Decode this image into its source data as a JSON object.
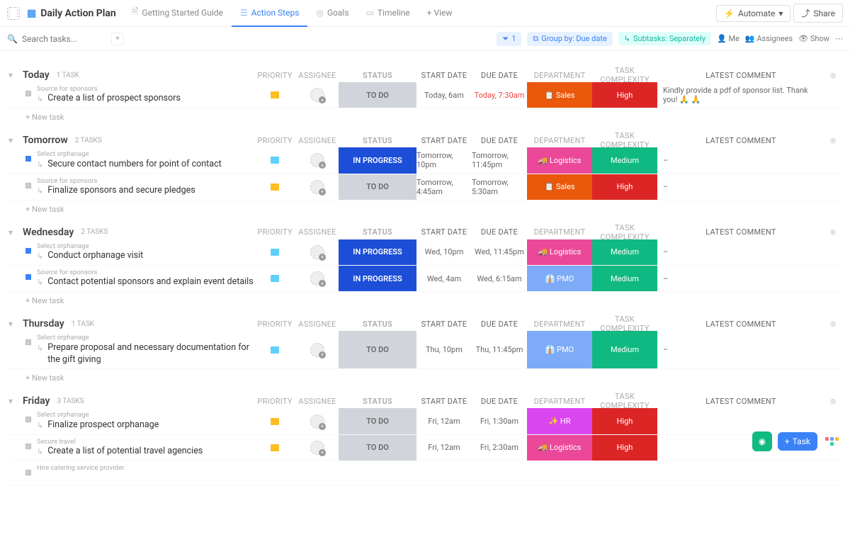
{
  "header": {
    "title": "Daily Action Plan",
    "tabs": [
      {
        "label": "Getting Started Guide"
      },
      {
        "label": "Action Steps"
      },
      {
        "label": "Goals"
      },
      {
        "label": "Timeline"
      }
    ],
    "add_view": "+ View",
    "automate": "Automate",
    "share": "Share"
  },
  "toolbar": {
    "search_placeholder": "Search tasks...",
    "filter_count": "1",
    "group_by": "Group by: Due date",
    "subtasks": "Subtasks: Separately",
    "me": "Me",
    "assignees": "Assignees",
    "show": "Show"
  },
  "columns": {
    "priority": "PRIORITY",
    "assignee": "ASSIGNEE",
    "status": "STATUS",
    "start": "START DATE",
    "due": "DUE DATE",
    "dept": "DEPARTMENT",
    "complex": "TASK COMPLEXITY",
    "comment": "LATEST COMMENT"
  },
  "groups": [
    {
      "name": "Today",
      "count": "1 TASK",
      "tasks": [
        {
          "crumb": "Source for sponsors",
          "name": "Create a list of prospect sponsors",
          "flag": "yellow",
          "status": "TO DO",
          "status_bg": "#d1d5db",
          "status_fg": "#666",
          "start": "Today, 6am",
          "due": "Today, 7:30am",
          "due_red": true,
          "dept": "📋 Sales",
          "dept_bg": "#ea580c",
          "complex": "High",
          "complex_bg": "#dc2626",
          "comment": "Kindly provide a pdf of sponsor list. Thank you! 🙏 🙏",
          "sq": "grey"
        }
      ]
    },
    {
      "name": "Tomorrow",
      "count": "2 TASKS",
      "tasks": [
        {
          "crumb": "Select orphanage",
          "name": "Secure contact numbers for point of contact",
          "flag": "cyan",
          "status": "IN PROGRESS",
          "status_bg": "#1d4ed8",
          "status_fg": "#fff",
          "start": "Tomorrow, 10pm",
          "due": "Tomorrow, 11:45pm",
          "dept": "🚚 Logistics",
          "dept_bg": "#ec4899",
          "complex": "Medium",
          "complex_bg": "#10b981",
          "comment": "–",
          "sq": "blue"
        },
        {
          "crumb": "Source for sponsors",
          "name": "Finalize sponsors and secure pledges",
          "flag": "yellow",
          "status": "TO DO",
          "status_bg": "#d1d5db",
          "status_fg": "#666",
          "start": "Tomorrow, 4:45am",
          "due": "Tomorrow, 5:30am",
          "dept": "📋 Sales",
          "dept_bg": "#ea580c",
          "complex": "High",
          "complex_bg": "#dc2626",
          "comment": "–",
          "sq": "grey"
        }
      ]
    },
    {
      "name": "Wednesday",
      "count": "2 TASKS",
      "tasks": [
        {
          "crumb": "Select orphanage",
          "name": "Conduct orphanage visit",
          "flag": "cyan",
          "status": "IN PROGRESS",
          "status_bg": "#1d4ed8",
          "status_fg": "#fff",
          "start": "Wed, 10pm",
          "due": "Wed, 11:45pm",
          "dept": "🚚 Logistics",
          "dept_bg": "#ec4899",
          "complex": "Medium",
          "complex_bg": "#10b981",
          "comment": "–",
          "sq": "blue"
        },
        {
          "crumb": "Source for sponsors",
          "name": "Contact potential sponsors and explain event details",
          "flag": "cyan",
          "status": "IN PROGRESS",
          "status_bg": "#1d4ed8",
          "status_fg": "#fff",
          "start": "Wed, 4am",
          "due": "Wed, 6:15am",
          "dept": "👔 PMO",
          "dept_bg": "#7dabf8",
          "complex": "Medium",
          "complex_bg": "#10b981",
          "comment": "–",
          "sq": "blue"
        }
      ]
    },
    {
      "name": "Thursday",
      "count": "1 TASK",
      "tasks": [
        {
          "crumb": "Select orphanage",
          "name": "Prepare proposal and necessary documentation for the gift giving",
          "flag": "cyan",
          "status": "TO DO",
          "status_bg": "#d1d5db",
          "status_fg": "#666",
          "start": "Thu, 10pm",
          "due": "Thu, 11:45pm",
          "dept": "👔 PMO",
          "dept_bg": "#7dabf8",
          "complex": "Medium",
          "complex_bg": "#10b981",
          "comment": "–",
          "sq": "grey"
        }
      ]
    },
    {
      "name": "Friday",
      "count": "3 TASKS",
      "tasks": [
        {
          "crumb": "Select orphanage",
          "name": "Finalize prospect orphanage",
          "flag": "yellow",
          "status": "TO DO",
          "status_bg": "#d1d5db",
          "status_fg": "#666",
          "start": "Fri, 12am",
          "due": "Fri, 1:30am",
          "dept": "✨ HR",
          "dept_bg": "#d946ef",
          "complex": "High",
          "complex_bg": "#dc2626",
          "comment": "",
          "sq": "grey"
        },
        {
          "crumb": "Secure travel",
          "name": "Create a list of potential travel agencies",
          "flag": "yellow",
          "status": "TO DO",
          "status_bg": "#d1d5db",
          "status_fg": "#666",
          "start": "Fri, 12am",
          "due": "Fri, 2:30am",
          "dept": "🚚 Logistics",
          "dept_bg": "#ec4899",
          "complex": "High",
          "complex_bg": "#dc2626",
          "comment": "",
          "sq": "grey"
        },
        {
          "crumb": "Hire catering service provider",
          "name": "",
          "flag": "",
          "status": "",
          "status_bg": "",
          "status_fg": "",
          "start": "",
          "due": "",
          "dept": "",
          "dept_bg": "",
          "complex": "",
          "complex_bg": "",
          "comment": "",
          "sq": "grey",
          "partial": true
        }
      ]
    }
  ],
  "misc": {
    "newtask": "+ New task",
    "task_btn": "Task"
  }
}
